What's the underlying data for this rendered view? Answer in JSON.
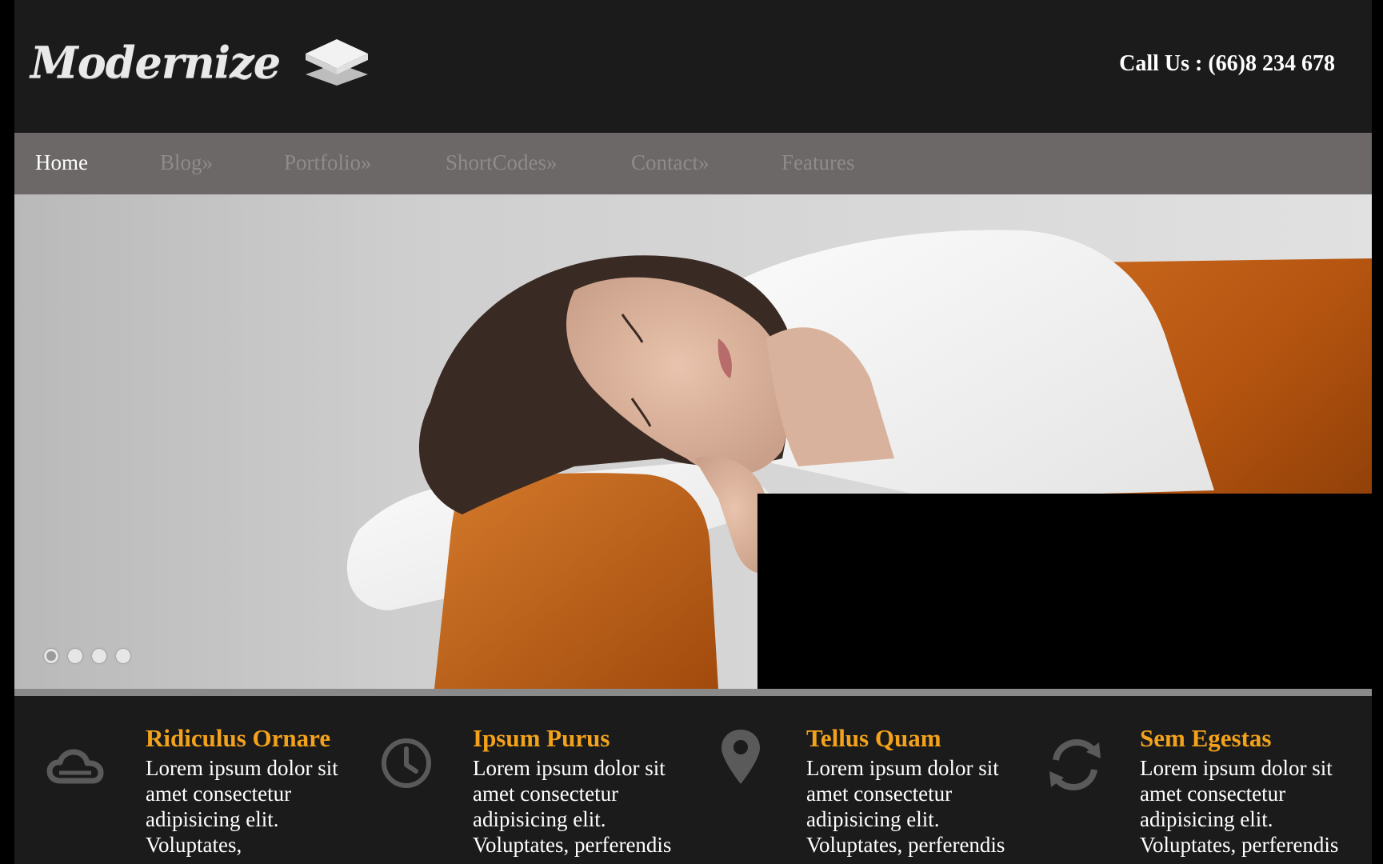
{
  "header": {
    "logo_text": "Modernize",
    "call_us": "Call Us : (66)8 234 678"
  },
  "nav": {
    "items": [
      {
        "label": "Home",
        "active": true
      },
      {
        "label": "Blog»",
        "active": false
      },
      {
        "label": "Portfolio»",
        "active": false
      },
      {
        "label": "ShortCodes»",
        "active": false
      },
      {
        "label": "Contact»",
        "active": false
      },
      {
        "label": "Features",
        "active": false
      }
    ]
  },
  "slider": {
    "image_subject": "woman sleeping on orange sofa",
    "dots": [
      {
        "active": true
      },
      {
        "active": false
      },
      {
        "active": false
      },
      {
        "active": false
      }
    ]
  },
  "features": [
    {
      "icon": "cloud-icon",
      "title": "Ridiculus Ornare",
      "text": "Lorem ipsum dolor sit amet consectetur adipisicing elit. Voluptates,"
    },
    {
      "icon": "clock-icon",
      "title": "Ipsum Purus",
      "text": "Lorem ipsum dolor sit amet consectetur adipisicing elit. Voluptates, perferendis"
    },
    {
      "icon": "map-pin-icon",
      "title": "Tellus Quam",
      "text": "Lorem ipsum dolor sit amet consectetur adipisicing elit. Voluptates, perferendis"
    },
    {
      "icon": "refresh-icon",
      "title": "Sem Egestas",
      "text": "Lorem ipsum dolor sit amet consectetur adipisicing elit. Voluptates, perferendis"
    }
  ],
  "colors": {
    "background": "#1b1b1b",
    "nav_background": "#6b6867",
    "nav_inactive": "#8e8b8a",
    "accent": "#f3a21b",
    "caption_box": "#000000"
  }
}
